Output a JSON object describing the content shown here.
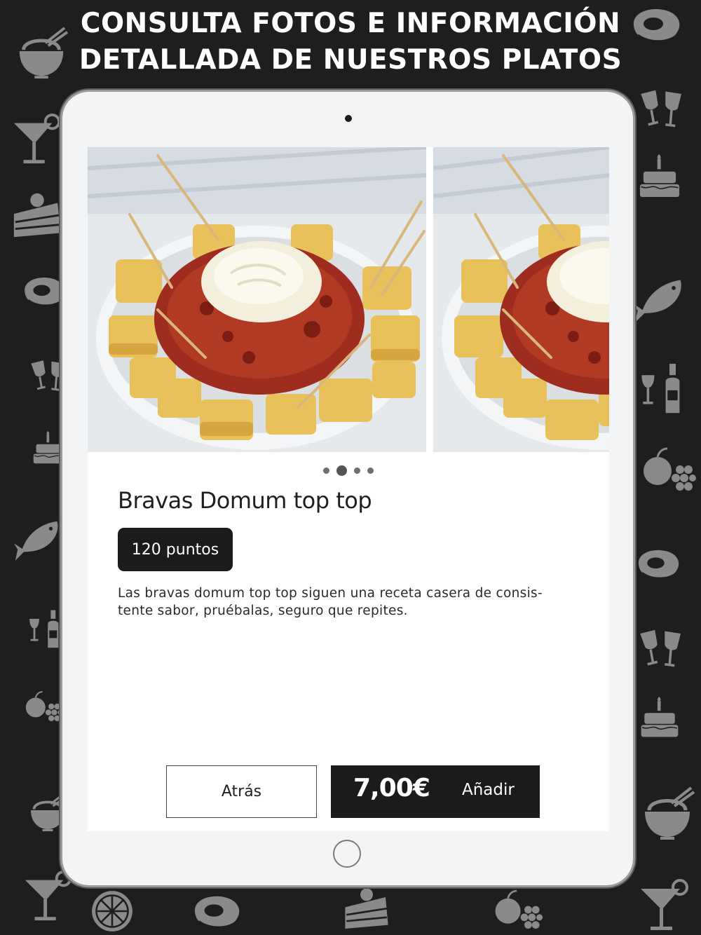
{
  "headline": {
    "line1": "CONSULTA FOTOS E INFORMACIÓN",
    "line2": "DETALLADA DE NUESTROS PLATOS"
  },
  "background_icons": [
    "noodle-bowl-icon",
    "steak-icon",
    "cocktail-icon",
    "wine-glasses-icon",
    "cake-slice-icon",
    "birthday-cake-icon",
    "steak-icon",
    "fish-icon",
    "wine-glasses-icon",
    "wine-bottle-icon",
    "birthday-cake-icon",
    "fruit-icon",
    "fish-icon",
    "steak-icon",
    "wine-bottle-icon",
    "wine-glasses-icon",
    "fruit-icon",
    "birthday-cake-icon",
    "noodle-bowl-icon",
    "noodle-bowl-icon",
    "cocktail-icon",
    "citrus-slice-icon",
    "steak-icon",
    "cake-slice-icon",
    "fruit-icon",
    "cocktail-icon"
  ],
  "dish": {
    "title": "Bravas Domum top top",
    "points": "120 puntos",
    "description_line1": "Las bravas domum top top siguen una receta casera de consis-",
    "description_line2": "tente sabor, pruébalas, seguro que repites.",
    "photos": [
      "patatas-bravas-photo",
      "patatas-bravas-photo"
    ]
  },
  "carousel": {
    "total": 4,
    "current": 2
  },
  "actions": {
    "back_label": "Atrás",
    "price": "7,00€",
    "add_label": "Añadir"
  },
  "colors": {
    "background": "#1e1e1e",
    "icons": "#8a8a8a",
    "buttons": "#1b1b1b"
  }
}
